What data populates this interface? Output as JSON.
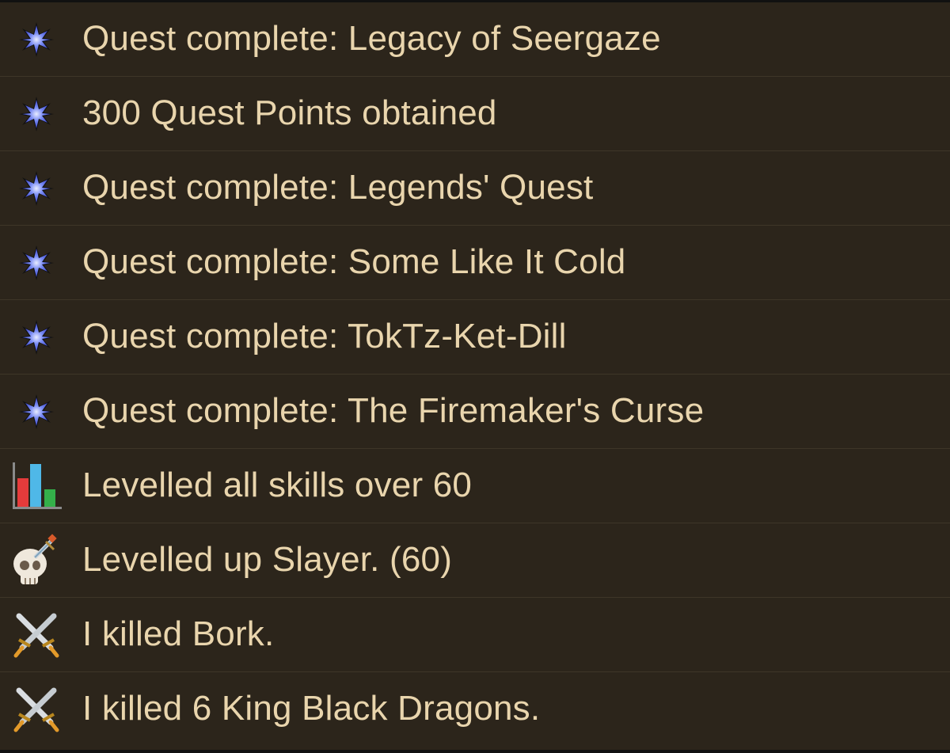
{
  "feed": {
    "entries": [
      {
        "icon": "quest-star-icon",
        "text": "Quest complete: Legacy of Seergaze"
      },
      {
        "icon": "quest-star-icon",
        "text": "300 Quest Points obtained"
      },
      {
        "icon": "quest-star-icon",
        "text": "Quest complete: Legends' Quest"
      },
      {
        "icon": "quest-star-icon",
        "text": "Quest complete: Some Like It Cold"
      },
      {
        "icon": "quest-star-icon",
        "text": "Quest complete: TokTz-Ket-Dill"
      },
      {
        "icon": "quest-star-icon",
        "text": "Quest complete: The Firemaker's Curse"
      },
      {
        "icon": "skills-bar-chart-icon",
        "text": "Levelled all skills over 60"
      },
      {
        "icon": "slayer-skull-icon",
        "text": "Levelled up Slayer. (60)"
      },
      {
        "icon": "crossed-swords-icon",
        "text": "I killed Bork."
      },
      {
        "icon": "crossed-swords-icon",
        "text": "I killed 6 King Black Dragons."
      }
    ]
  },
  "colors": {
    "background": "#2c251b",
    "text": "#e9d5ad",
    "divider": "#3e3628"
  }
}
